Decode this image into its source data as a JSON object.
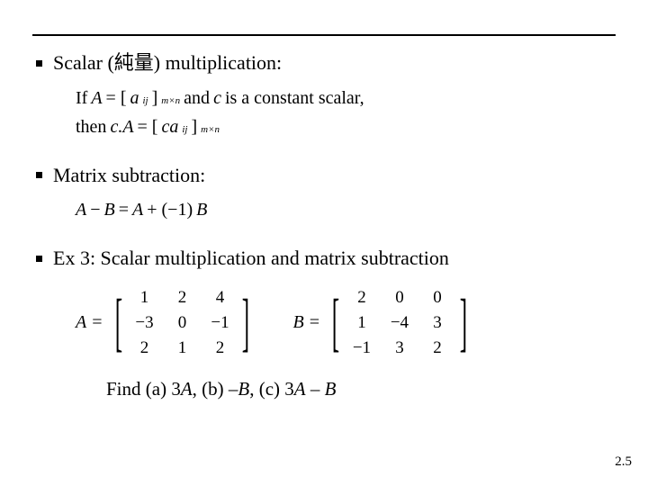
{
  "rule": true,
  "bullets": {
    "b1": "Scalar (純量) multiplication:",
    "b2": "Matrix subtraction:",
    "b3": "Ex 3: Scalar multiplication and matrix subtraction"
  },
  "scalar_def": {
    "line1_prefix": "If ",
    "line1_A": "A",
    "line1_eq": " = [",
    "line1_aij": "a",
    "line1_ij": "ij",
    "line1_close": "]",
    "line1_mn": "m×n",
    "line1_and": " and ",
    "line1_c": "c",
    "line1_rest": " is a constant scalar,",
    "line2_prefix": "then ",
    "line2_cA": "c.A",
    "line2_eq": " = [",
    "line2_caij": "ca",
    "line2_ij": "ij",
    "line2_close": "]",
    "line2_mn": "m×n"
  },
  "subtraction": {
    "lhs_A": "A",
    "minus": " − ",
    "lhs_B": "B",
    "eq": " = ",
    "rhs_A": "A",
    "plus": " + (−1)",
    "rhs_B": "B"
  },
  "matrices": {
    "A_label": "A",
    "B_label": "B",
    "eq": " = ",
    "A": [
      [
        "1",
        "2",
        "4"
      ],
      [
        "−3",
        "0",
        "−1"
      ],
      [
        "2",
        "1",
        "2"
      ]
    ],
    "B": [
      [
        "2",
        "0",
        "0"
      ],
      [
        "1",
        "−4",
        "3"
      ],
      [
        "−1",
        "3",
        "2"
      ]
    ]
  },
  "find": {
    "prefix": "Find (a) 3",
    "A1": "A",
    "mid1": ",  (b) –",
    "B1": "B",
    "mid2": ",  (c) 3",
    "A2": "A",
    "mid3": " – ",
    "B2": "B"
  },
  "page": "2.5"
}
